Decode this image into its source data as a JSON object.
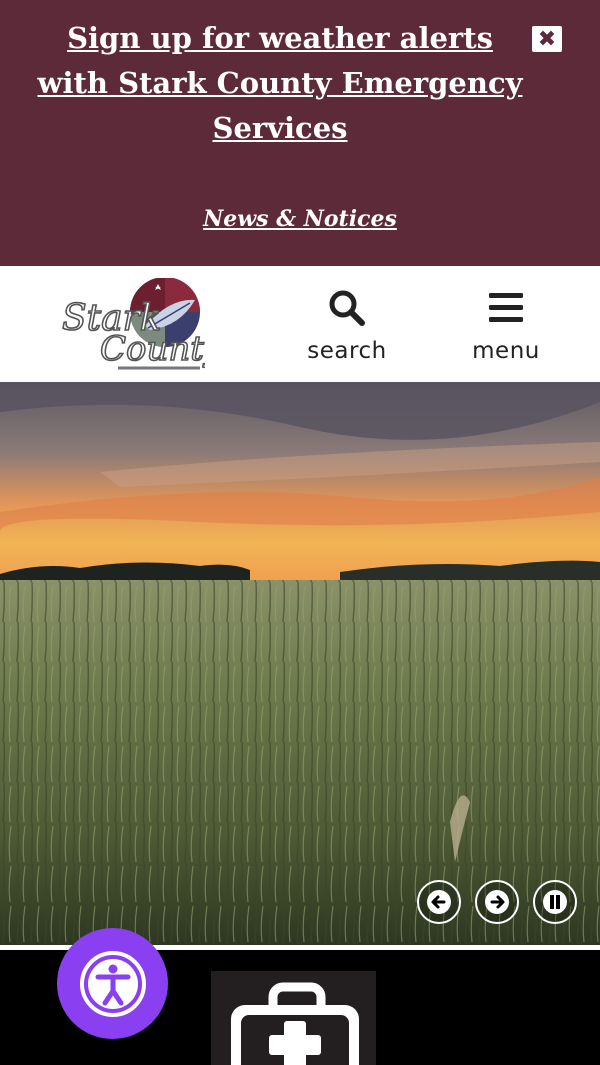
{
  "alert": {
    "title": "Sign up for weather alerts with Stark County Emergency Services",
    "news_link": "News & Notices",
    "close_glyph": "✖",
    "background": "#5d2a39"
  },
  "header": {
    "logo_name": "Stark County North Dakota",
    "search_label": "search",
    "menu_label": "menu"
  },
  "slideshow": {
    "prev_label": "Previous slide",
    "next_label": "Next slide",
    "pause_label": "Pause slideshow"
  },
  "accessibility": {
    "label": "Accessibility menu",
    "color": "#8a3ff0"
  },
  "quick_link": {
    "icon": "first-aid-kit-icon"
  }
}
